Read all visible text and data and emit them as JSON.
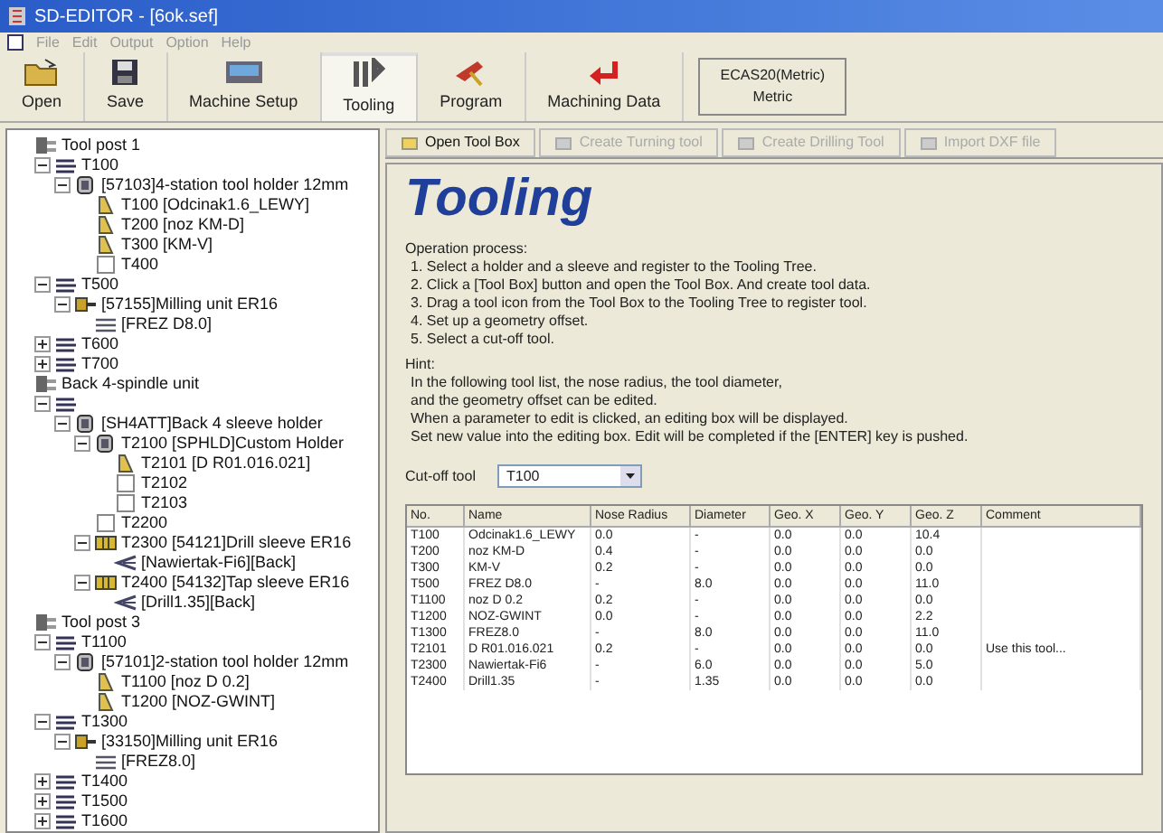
{
  "window": {
    "title": "SD-EDITOR - [6ok.sef]"
  },
  "menu": [
    "File",
    "Edit",
    "Output",
    "Option",
    "Help"
  ],
  "toolbar": [
    {
      "label": "Open",
      "kind": "open",
      "selected": false
    },
    {
      "label": "Save",
      "kind": "save",
      "selected": false
    },
    {
      "label": "Machine Setup",
      "kind": "machine",
      "selected": false
    },
    {
      "label": "Tooling",
      "kind": "tooling",
      "selected": true
    },
    {
      "label": "Program",
      "kind": "program",
      "selected": false
    },
    {
      "label": "Machining Data",
      "kind": "data",
      "selected": false
    }
  ],
  "machine_box": {
    "model": "ECAS20(Metric)",
    "units": "Metric"
  },
  "tree": [
    {
      "label": "Tool post 1",
      "kind": "post",
      "children": [
        {
          "label": "T100",
          "kind": "station",
          "expanded": true,
          "children": [
            {
              "label": "[57103]4-station tool holder 12mm",
              "kind": "holder",
              "expanded": true,
              "children": [
                {
                  "label": "T100 [Odcinak1.6_LEWY]",
                  "kind": "turning"
                },
                {
                  "label": "T200 [noz KM-D]",
                  "kind": "turning"
                },
                {
                  "label": "T300 [KM-V]",
                  "kind": "turning"
                },
                {
                  "label": "T400",
                  "kind": "empty"
                }
              ]
            }
          ]
        },
        {
          "label": "T500",
          "kind": "station",
          "expanded": true,
          "children": [
            {
              "label": "[57155]Milling unit ER16",
              "kind": "mill",
              "expanded": true,
              "children": [
                {
                  "label": "[FREZ D8.0]",
                  "kind": "endmill"
                }
              ]
            }
          ]
        },
        {
          "label": "T600",
          "kind": "station",
          "expanded": false
        },
        {
          "label": "T700",
          "kind": "station",
          "expanded": false
        }
      ]
    },
    {
      "label": "Back 4-spindle unit",
      "kind": "post",
      "children": [
        {
          "kind": "station",
          "expanded": true,
          "children": [
            {
              "label": "[SH4ATT]Back 4 sleeve holder",
              "kind": "holder",
              "expanded": true,
              "children": [
                {
                  "label": "T2100 [SPHLD]Custom Holder",
                  "kind": "holder",
                  "expanded": true,
                  "children": [
                    {
                      "label": "T2101 [D R01.016.021]",
                      "kind": "turning"
                    },
                    {
                      "label": "T2102",
                      "kind": "empty"
                    },
                    {
                      "label": "T2103",
                      "kind": "empty"
                    }
                  ]
                },
                {
                  "label": "T2200",
                  "kind": "empty"
                },
                {
                  "label": "T2300 [54121]Drill sleeve ER16",
                  "kind": "sleeve",
                  "expanded": true,
                  "children": [
                    {
                      "label": "[Nawiertak-Fi6][Back]",
                      "kind": "drill"
                    }
                  ]
                },
                {
                  "label": "T2400 [54132]Tap sleeve ER16",
                  "kind": "sleeve",
                  "expanded": true,
                  "children": [
                    {
                      "label": "[Drill1.35][Back]",
                      "kind": "drill"
                    }
                  ]
                }
              ]
            }
          ]
        }
      ]
    },
    {
      "label": "Tool post 3",
      "kind": "post",
      "children": [
        {
          "label": "T1100",
          "kind": "station",
          "expanded": true,
          "children": [
            {
              "label": "[57101]2-station tool holder 12mm",
              "kind": "holder",
              "expanded": true,
              "children": [
                {
                  "label": "T1100 [noz D 0.2]",
                  "kind": "turning"
                },
                {
                  "label": "T1200 [NOZ-GWINT]",
                  "kind": "turning"
                }
              ]
            }
          ]
        },
        {
          "label": "T1300",
          "kind": "station",
          "expanded": true,
          "children": [
            {
              "label": "[33150]Milling unit ER16",
              "kind": "mill",
              "expanded": true,
              "children": [
                {
                  "label": "[FREZ8.0]",
                  "kind": "endmill"
                }
              ]
            }
          ]
        },
        {
          "label": "T1400",
          "kind": "station",
          "expanded": false
        },
        {
          "label": "T1500",
          "kind": "station",
          "expanded": false
        },
        {
          "label": "T1600",
          "kind": "station",
          "expanded": false
        }
      ]
    }
  ],
  "tool_buttons": [
    {
      "label": "Open Tool Box",
      "disabled": false
    },
    {
      "label": "Create Turning tool",
      "disabled": true
    },
    {
      "label": "Create Drilling Tool",
      "disabled": true
    },
    {
      "label": "Import DXF file",
      "disabled": true
    }
  ],
  "heading": "Tooling",
  "process_title": "Operation process:",
  "steps": [
    "1. Select a holder and a sleeve and register to the Tooling Tree.",
    "2. Click a [Tool Box] button and open the Tool Box. And create tool data.",
    "3. Drag a tool icon from the Tool Box to the Tooling Tree to register tool.",
    "4. Set up a geometry offset.",
    "5. Select a cut-off tool."
  ],
  "hint_title": "Hint:",
  "hints": [
    "In the following tool list, the nose radius, the tool diameter,",
    "and the geometry offset can be edited.",
    "When a parameter to edit is clicked, an editing box will be displayed.",
    "Set new value into the editing box. Edit will be completed if the [ENTER] key is pushed."
  ],
  "cutoff": {
    "label": "Cut-off tool",
    "value": "T100"
  },
  "table": {
    "columns": [
      "No.",
      "Name",
      "Nose Radius",
      "Diameter",
      "Geo. X",
      "Geo. Y",
      "Geo. Z",
      "Comment"
    ],
    "rows": [
      [
        "T100",
        "Odcinak1.6_LEWY",
        "0.0",
        "-",
        "0.0",
        "0.0",
        "10.4",
        ""
      ],
      [
        "T200",
        "noz KM-D",
        "0.4",
        "-",
        "0.0",
        "0.0",
        "0.0",
        ""
      ],
      [
        "T300",
        "KM-V",
        "0.2",
        "-",
        "0.0",
        "0.0",
        "0.0",
        ""
      ],
      [
        "T500",
        "FREZ D8.0",
        "-",
        "8.0",
        "0.0",
        "0.0",
        "11.0",
        ""
      ],
      [
        "T1100",
        "noz D 0.2",
        "0.2",
        "-",
        "0.0",
        "0.0",
        "0.0",
        ""
      ],
      [
        "T1200",
        "NOZ-GWINT",
        "0.0",
        "-",
        "0.0",
        "0.0",
        "2.2",
        ""
      ],
      [
        "T1300",
        "FREZ8.0",
        "-",
        "8.0",
        "0.0",
        "0.0",
        "11.0",
        ""
      ],
      [
        "T2101",
        "D R01.016.021",
        "0.2",
        "-",
        "0.0",
        "0.0",
        "0.0",
        "Use this tool..."
      ],
      [
        "T2300",
        "Nawiertak-Fi6",
        "-",
        "6.0",
        "0.0",
        "0.0",
        "5.0",
        ""
      ],
      [
        "T2400",
        "Drill1.35",
        "-",
        "1.35",
        "0.0",
        "0.0",
        "0.0",
        ""
      ]
    ]
  }
}
